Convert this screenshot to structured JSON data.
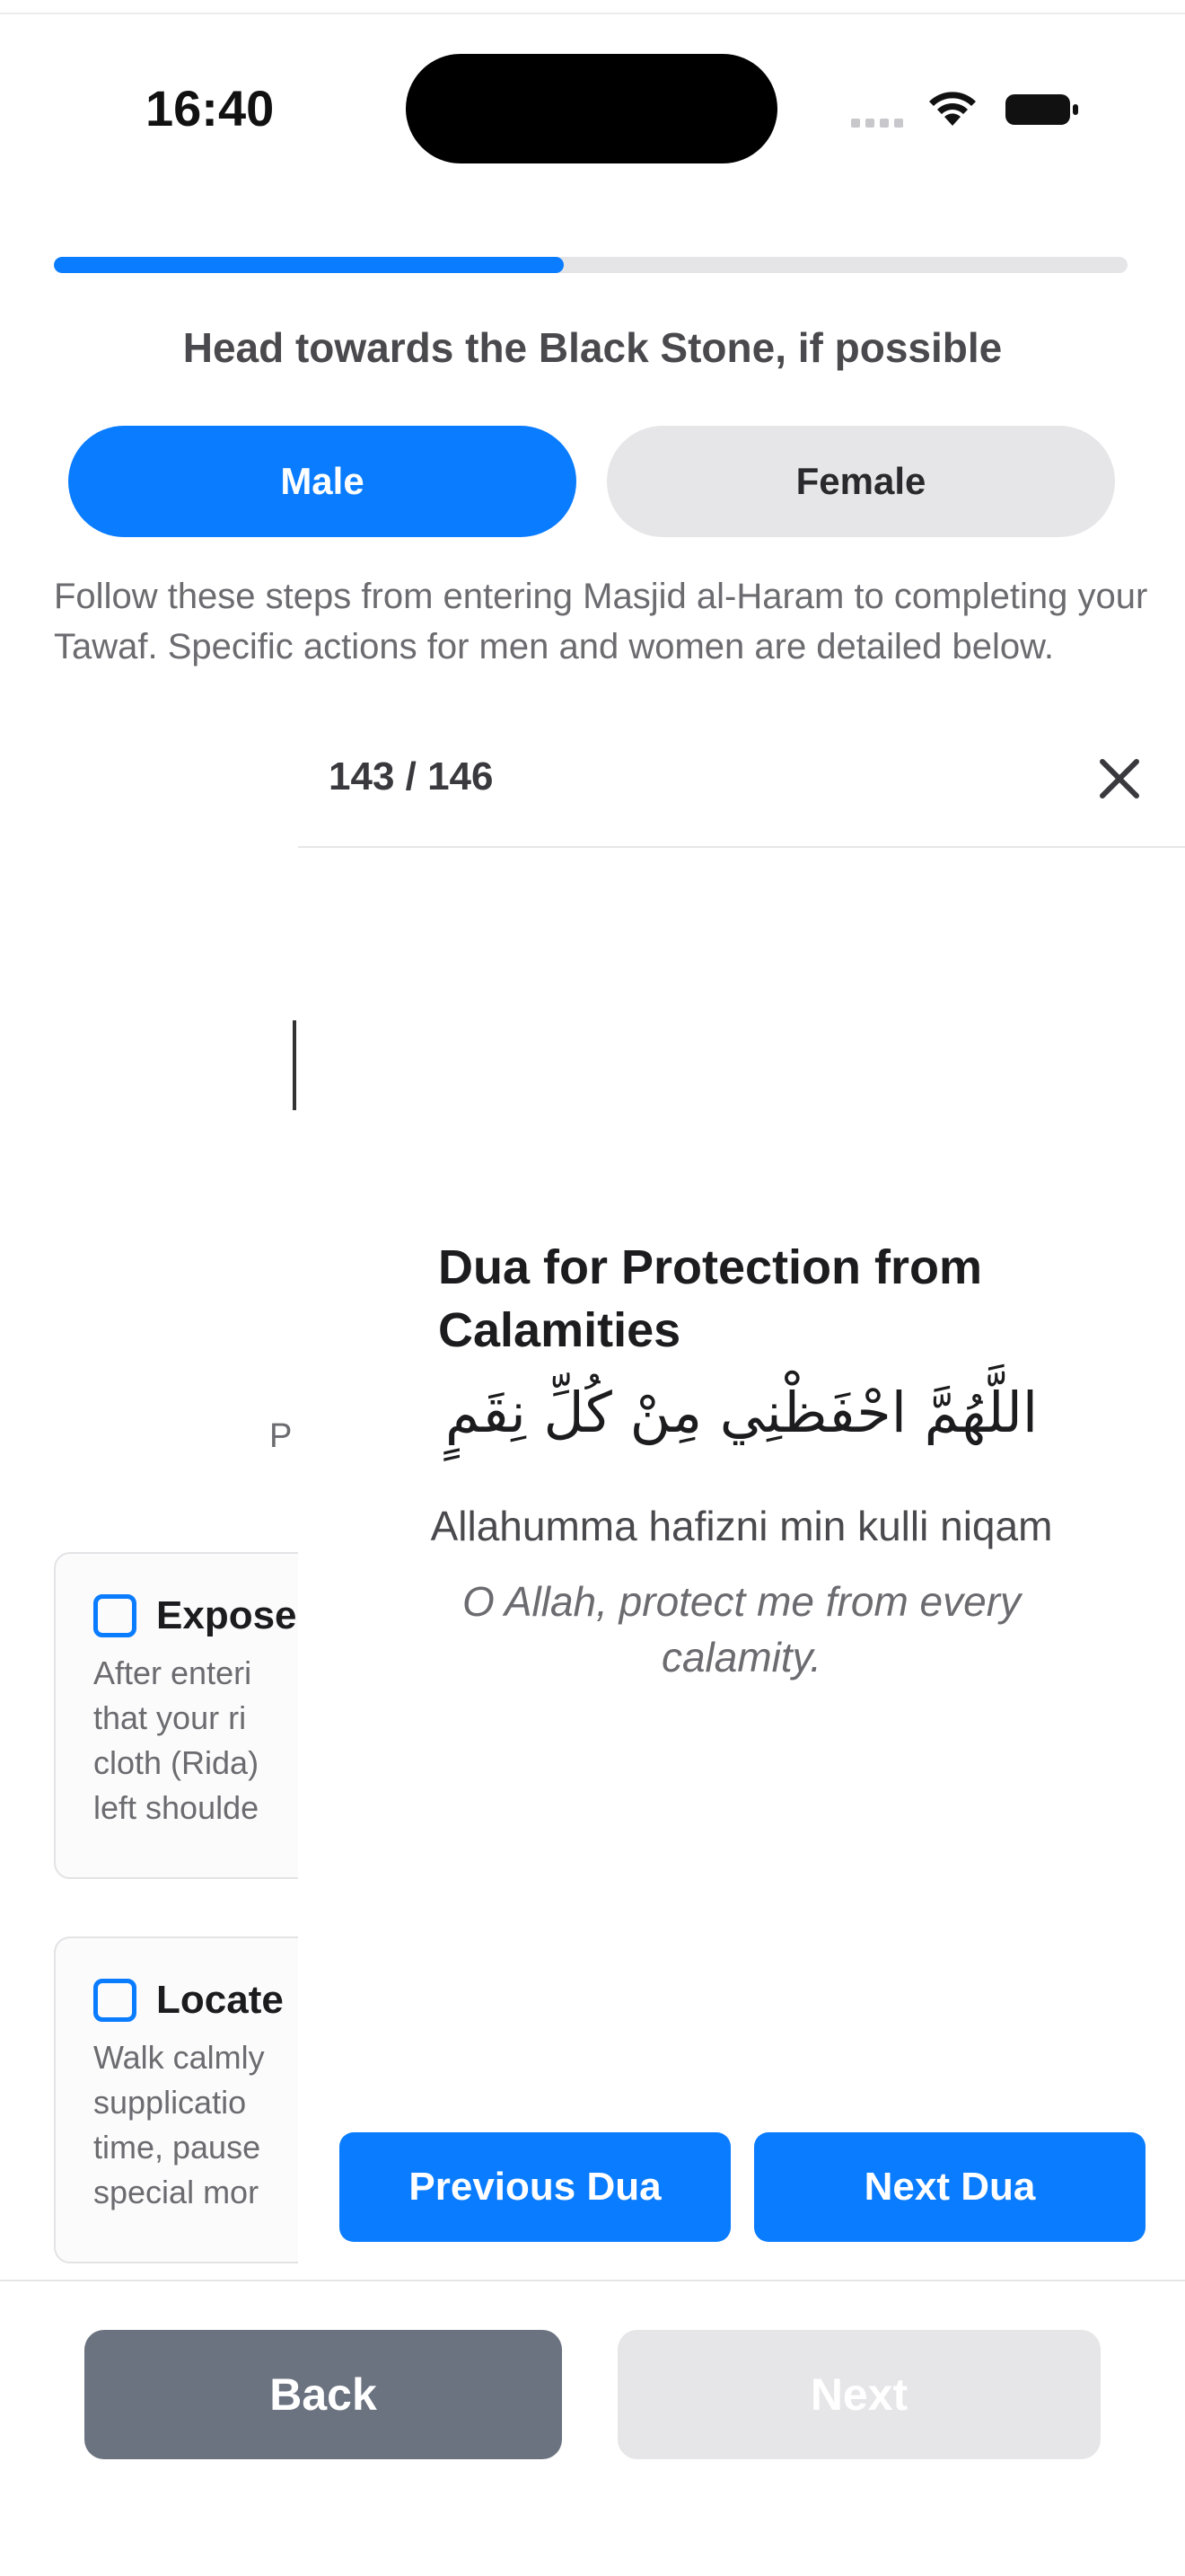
{
  "status": {
    "time": "16:40",
    "icons": [
      "signal-icon",
      "wifi-icon",
      "battery-icon"
    ]
  },
  "progress": {
    "fraction": 0.475,
    "color": "#0a7cff"
  },
  "step": {
    "title": "Head towards the Black Stone, if possible"
  },
  "gender_toggle": {
    "male_label": "Male",
    "female_label": "Female",
    "selected": "Male"
  },
  "intro": "Follow these steps from entering Masjid al-Haram to completing your Tawaf. Specific actions for men and women are detailed below.",
  "background_content": {
    "partial_text": "P",
    "cards": [
      {
        "title": "Expose",
        "body": "After enteri\nthat your ri\ncloth (Rida)\nleft shoulde"
      },
      {
        "title": "Locate",
        "body": "Walk calmly\nsupplicatio\ntime, pause\nspecial mor"
      }
    ]
  },
  "dua_modal": {
    "counter": "143 / 146",
    "title": "Dua for Protection from Calamities",
    "arabic": "اللَّهُمَّ احْفَظْنِي مِنْ كُلِّ نِقَمٍ",
    "transliteration": "Allahumma hafizni min kulli niqam",
    "translation": "O Allah, protect me from every calamity.",
    "prev_label": "Previous Dua",
    "next_label": "Next Dua"
  },
  "navigation": {
    "back_label": "Back",
    "next_label": "Next"
  },
  "colors": {
    "accent": "#0a7cff",
    "back_button": "#6b7280",
    "disabled": "#e6e6e8"
  }
}
